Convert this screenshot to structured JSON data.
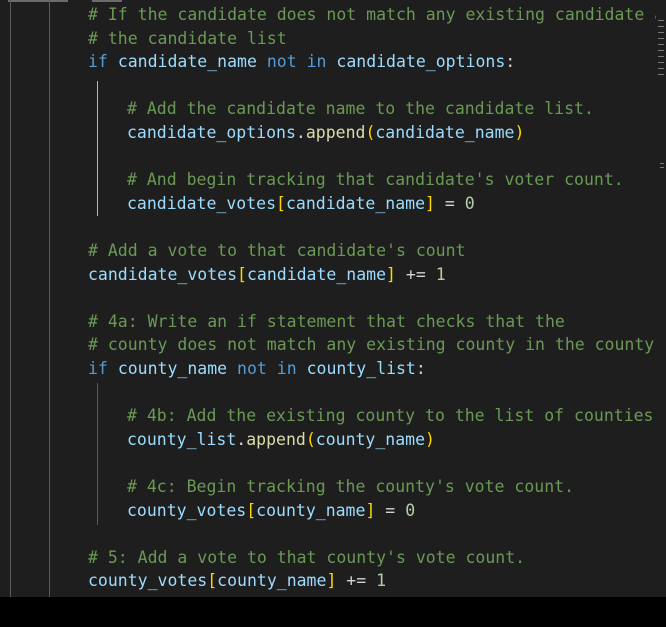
{
  "editor": {
    "lines": [
      {
        "tokens": [
          {
            "t": "# If the candidate does not match any existing candidate ad",
            "c": "comment"
          }
        ]
      },
      {
        "tokens": [
          {
            "t": "# the candidate list",
            "c": "comment"
          }
        ]
      },
      {
        "tokens": [
          {
            "t": "if",
            "c": "kw"
          },
          {
            "t": " ",
            "c": "plain"
          },
          {
            "t": "candidate_name",
            "c": "var"
          },
          {
            "t": " ",
            "c": "plain"
          },
          {
            "t": "not",
            "c": "kw"
          },
          {
            "t": " ",
            "c": "plain"
          },
          {
            "t": "in",
            "c": "kw"
          },
          {
            "t": " ",
            "c": "plain"
          },
          {
            "t": "candidate_options",
            "c": "var"
          },
          {
            "t": ":",
            "c": "plain"
          }
        ]
      },
      {
        "tokens": []
      },
      {
        "tokens": [
          {
            "t": "# Add the candidate name to the candidate list.",
            "c": "comment"
          }
        ]
      },
      {
        "tokens": [
          {
            "t": "candidate_options",
            "c": "var"
          },
          {
            "t": ".",
            "c": "plain"
          },
          {
            "t": "append",
            "c": "fn"
          },
          {
            "t": "(",
            "c": "br"
          },
          {
            "t": "candidate_name",
            "c": "var"
          },
          {
            "t": ")",
            "c": "br"
          }
        ]
      },
      {
        "tokens": []
      },
      {
        "tokens": [
          {
            "t": "# And begin tracking that candidate's voter count.",
            "c": "comment"
          }
        ]
      },
      {
        "tokens": [
          {
            "t": "candidate_votes",
            "c": "var"
          },
          {
            "t": "[",
            "c": "br"
          },
          {
            "t": "candidate_name",
            "c": "var"
          },
          {
            "t": "]",
            "c": "br"
          },
          {
            "t": " = ",
            "c": "op"
          },
          {
            "t": "0",
            "c": "num"
          }
        ]
      },
      {
        "tokens": []
      },
      {
        "tokens": [
          {
            "t": "# Add a vote to that candidate's count",
            "c": "comment"
          }
        ]
      },
      {
        "tokens": [
          {
            "t": "candidate_votes",
            "c": "var"
          },
          {
            "t": "[",
            "c": "br"
          },
          {
            "t": "candidate_name",
            "c": "var"
          },
          {
            "t": "]",
            "c": "br"
          },
          {
            "t": " += ",
            "c": "op"
          },
          {
            "t": "1",
            "c": "num"
          }
        ]
      },
      {
        "tokens": []
      },
      {
        "tokens": [
          {
            "t": "# 4a: Write an if statement that checks that the",
            "c": "comment"
          }
        ]
      },
      {
        "tokens": [
          {
            "t": "# county does not match any existing county in the county l",
            "c": "comment"
          }
        ]
      },
      {
        "tokens": [
          {
            "t": "if",
            "c": "kw"
          },
          {
            "t": " ",
            "c": "plain"
          },
          {
            "t": "county_name",
            "c": "var"
          },
          {
            "t": " ",
            "c": "plain"
          },
          {
            "t": "not",
            "c": "kw"
          },
          {
            "t": " ",
            "c": "plain"
          },
          {
            "t": "in",
            "c": "kw"
          },
          {
            "t": " ",
            "c": "plain"
          },
          {
            "t": "county_list",
            "c": "var"
          },
          {
            "t": ":",
            "c": "plain"
          }
        ]
      },
      {
        "tokens": []
      },
      {
        "tokens": [
          {
            "t": "# 4b: Add the existing county to the list of counties.",
            "c": "comment"
          }
        ]
      },
      {
        "tokens": [
          {
            "t": "county_list",
            "c": "var"
          },
          {
            "t": ".",
            "c": "plain"
          },
          {
            "t": "append",
            "c": "fn"
          },
          {
            "t": "(",
            "c": "br"
          },
          {
            "t": "county_name",
            "c": "var"
          },
          {
            "t": ")",
            "c": "br"
          }
        ]
      },
      {
        "tokens": []
      },
      {
        "tokens": [
          {
            "t": "# 4c: Begin tracking the county's vote count.",
            "c": "comment"
          }
        ]
      },
      {
        "tokens": [
          {
            "t": "county_votes",
            "c": "var"
          },
          {
            "t": "[",
            "c": "br"
          },
          {
            "t": "county_name",
            "c": "var"
          },
          {
            "t": "]",
            "c": "br"
          },
          {
            "t": " = ",
            "c": "op"
          },
          {
            "t": "0",
            "c": "num"
          }
        ]
      },
      {
        "tokens": []
      },
      {
        "tokens": [
          {
            "t": "# 5: Add a vote to that county's vote count.",
            "c": "comment"
          }
        ]
      },
      {
        "tokens": [
          {
            "t": "county_votes",
            "c": "var"
          },
          {
            "t": "[",
            "c": "br"
          },
          {
            "t": "county_name",
            "c": "var"
          },
          {
            "t": "]",
            "c": "br"
          },
          {
            "t": " += ",
            "c": "op"
          },
          {
            "t": "1",
            "c": "num"
          }
        ]
      }
    ]
  },
  "theme": {
    "background": "#1e1e1e",
    "comment": "#6a9955",
    "keyword": "#569cd6",
    "variable": "#9cdcfe",
    "function": "#dcdcaa",
    "number": "#b5cea8",
    "bracket": "#ffd700"
  }
}
